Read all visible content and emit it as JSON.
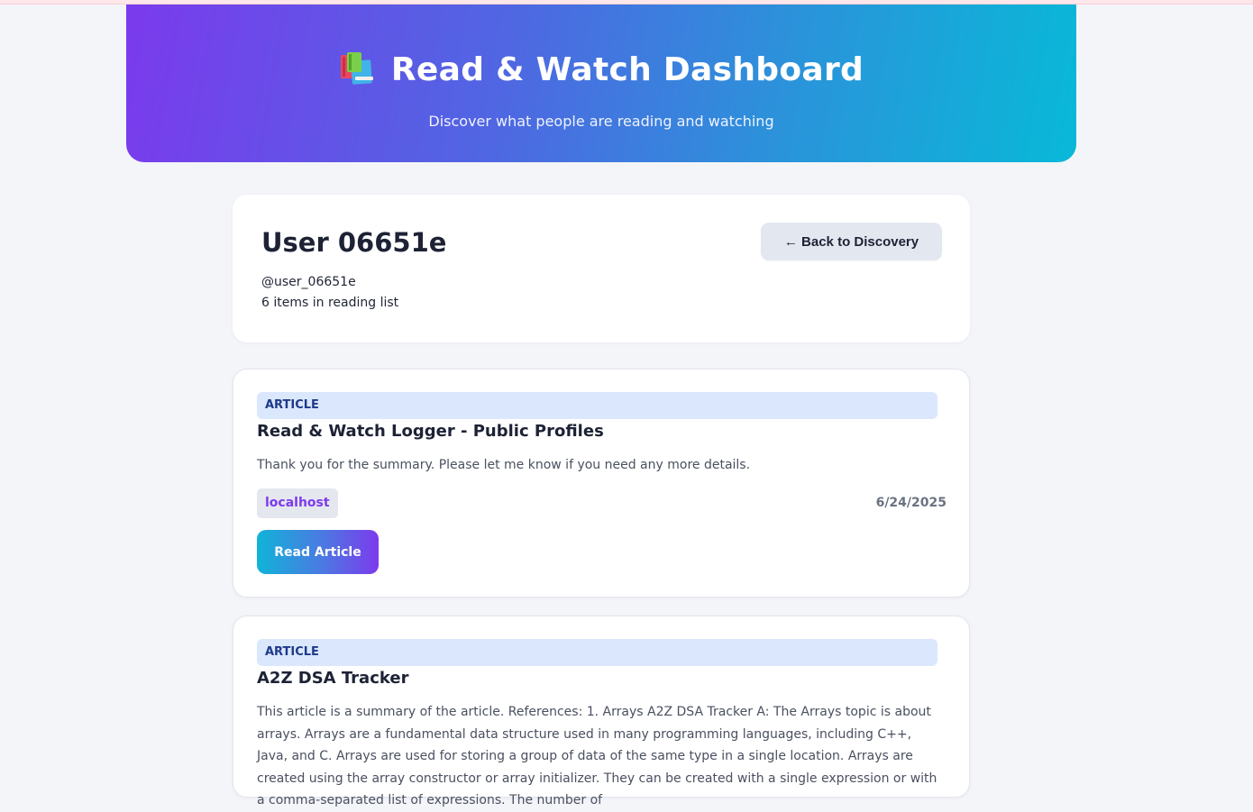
{
  "hero": {
    "title": "Read & Watch Dashboard",
    "subtitle": "Discover what people are reading and watching",
    "icon": "books-icon"
  },
  "profile": {
    "name": "User 06651e",
    "handle": "@user_06651e",
    "count_text": "6 items in reading list",
    "back_label": "← Back to Discovery"
  },
  "items": [
    {
      "type": "ARTICLE",
      "title": "Read & Watch Logger - Public Profiles",
      "description": "Thank you for the summary. Please let me know if you need any more details.",
      "source": "localhost",
      "date": "6/24/2025",
      "action_label": "Read Article"
    },
    {
      "type": "ARTICLE",
      "title": "A2Z DSA Tracker",
      "description": "This article is a summary of the article. References: 1. Arrays A2Z DSA Tracker A: The Arrays topic is about arrays. Arrays are a fundamental data structure used in many programming languages, including C++, Java, and C. Arrays are used for storing a group of data of the same type in a single location. Arrays are created using the array constructor or array initializer. They can be created with a single expression or with a comma-separated list of expressions. The number of"
    }
  ],
  "colors": {
    "hero_gradient_start": "#7b3aed",
    "hero_gradient_end": "#08b9d8",
    "badge_bg": "#dbe7fd",
    "badge_text": "#1e3a8a",
    "source_text": "#7c3aed",
    "page_bg": "#f4f5f9"
  }
}
